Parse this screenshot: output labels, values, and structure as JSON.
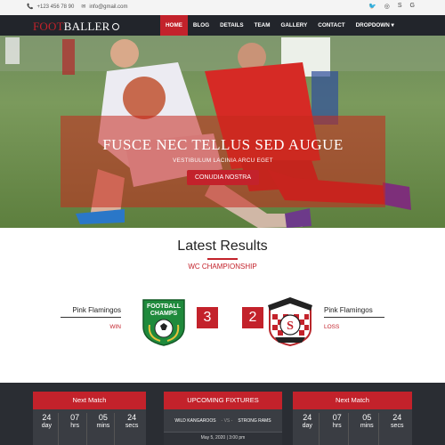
{
  "topbar": {
    "phone": "+123 456 78 90",
    "email": "info@gmail.com",
    "social_icons": [
      "twitter-icon",
      "instagram-icon",
      "skype-icon",
      "google-icon"
    ],
    "social_glyphs": [
      "🐦",
      "◎",
      "S",
      "G"
    ]
  },
  "logo": {
    "part1": "FOOT",
    "part2": "BALLER"
  },
  "nav": {
    "items": [
      "HOME",
      "BLOG",
      "DETAILS",
      "TEAM",
      "GALLERY",
      "CONTACT",
      "DROPDOWN ▾"
    ],
    "active_index": 0
  },
  "hero": {
    "title": "FUSCE NEC TELLUS SED AUGUE",
    "subtitle": "VESTIBULUM LACINIA ARCU EGET",
    "cta": "CONUDIA NOSTRA"
  },
  "results": {
    "heading": "Latest Results",
    "competition": "WC CHAMPIONSHIP",
    "home_team": "Pink Flamingos",
    "home_result": "WIN",
    "home_score": "3",
    "away_score": "2",
    "away_team": "Pink Flamingos",
    "away_result": "LOSS",
    "home_crest_text": "FOOTBALL CHAMPS"
  },
  "next_match_left": {
    "title": "Next Match",
    "countdown": [
      {
        "n": "24",
        "u": "day"
      },
      {
        "n": "07",
        "u": "hrs"
      },
      {
        "n": "05",
        "u": "mins"
      },
      {
        "n": "24",
        "u": "secs"
      }
    ]
  },
  "fixtures": {
    "title": "UPCOMING FIXTURES",
    "home": "WILD KANGAROOS",
    "vs": "- VS -",
    "away": "STRONG RAMS",
    "date": "May 5, 2020 | 3:00 pm"
  },
  "next_match_right": {
    "title": "Next Match",
    "countdown": [
      {
        "n": "24",
        "u": "day"
      },
      {
        "n": "07",
        "u": "hrs"
      },
      {
        "n": "05",
        "u": "mins"
      },
      {
        "n": "24",
        "u": "secs"
      }
    ]
  },
  "colors": {
    "accent": "#c3222b",
    "dark": "#22252b"
  }
}
